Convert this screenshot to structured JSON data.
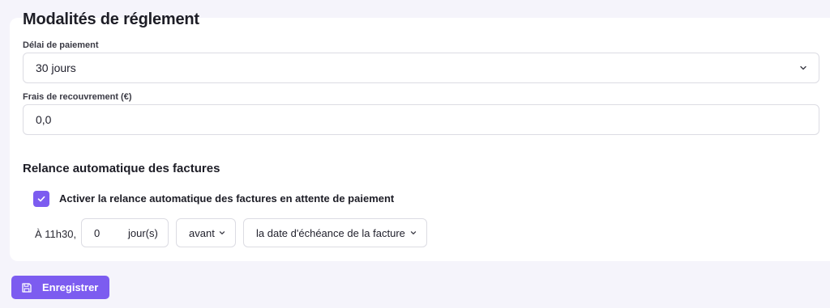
{
  "colors": {
    "accent": "#7c5cf0",
    "background": "#f5f4fb",
    "card": "#ffffff",
    "border": "#dcdce3"
  },
  "payment": {
    "title": "Modalités de réglement",
    "delay_label": "Délai de paiement",
    "delay_value": "30 jours",
    "fees_label": "Frais de recouvrement (€)",
    "fees_value": "0,0"
  },
  "reminder": {
    "title": "Relance automatique des factures",
    "checkbox_checked": true,
    "checkbox_label": "Activer la relance automatique des factures en attente de paiement",
    "time_prefix": "À 11h30,",
    "days_value": "0",
    "days_unit": "jour(s)",
    "timing_value": "avant",
    "reference_value": "la date d'échéance de la facture"
  },
  "actions": {
    "save_label": "Enregistrer",
    "save_icon": "floppy-disk-icon"
  }
}
